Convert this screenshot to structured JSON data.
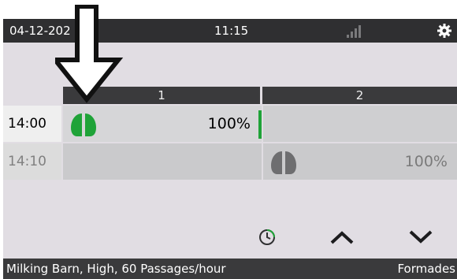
{
  "status": {
    "date": "04-12-202",
    "time": "11:15",
    "signal_icon": "signal-bars-icon",
    "settings_icon": "gear-icon"
  },
  "columns": [
    {
      "label": "1"
    },
    {
      "label": "2"
    }
  ],
  "rows": [
    {
      "time": "14:00",
      "col1_percent": "100%",
      "col1_icon": "hoof-icon",
      "col1_color": "#1fa338"
    },
    {
      "time": "14:10",
      "col2_percent": "100%",
      "col2_icon": "hoof-icon",
      "col2_color": "#6e6e70"
    }
  ],
  "toolbar": {
    "clock_icon": "clock-icon",
    "up_icon": "chevron-up-icon",
    "down_icon": "chevron-down-icon"
  },
  "footer": {
    "left": "Milking Barn, High, 60 Passages/hour",
    "right": "Formades"
  },
  "overlay": {
    "arrow_icon": "down-arrow-icon"
  }
}
